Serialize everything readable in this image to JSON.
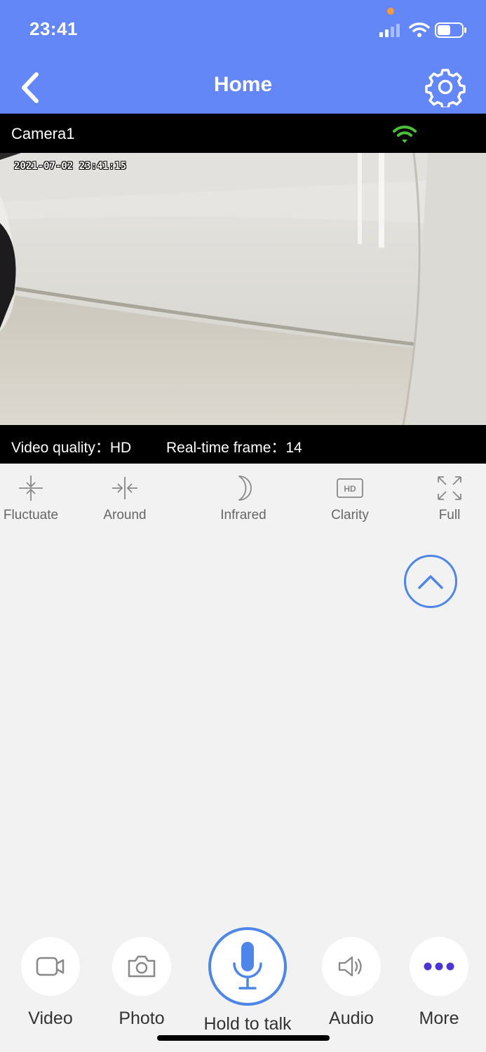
{
  "status_bar": {
    "time": "23:41"
  },
  "nav": {
    "title": "Home"
  },
  "camera": {
    "name": "Camera1",
    "timestamp": "2021-07-02 23:41:15"
  },
  "stream_info": {
    "quality": "Video quality：HD",
    "frame": "Real-time frame：14"
  },
  "controls": [
    {
      "label": "Fluctuate",
      "icon": "fluctuate-icon"
    },
    {
      "label": "Around",
      "icon": "around-icon"
    },
    {
      "label": "Infrared",
      "icon": "moon-icon"
    },
    {
      "label": "Clarity",
      "icon": "hd-icon"
    },
    {
      "label": "Full",
      "icon": "fullscreen-icon"
    }
  ],
  "actions": [
    {
      "label": "Video",
      "icon": "video-camera-icon"
    },
    {
      "label": "Photo",
      "icon": "camera-icon"
    },
    {
      "label": "Hold to talk",
      "icon": "microphone-icon"
    },
    {
      "label": "Audio",
      "icon": "speaker-icon"
    },
    {
      "label": "More",
      "icon": "more-dots-icon"
    }
  ],
  "colors": {
    "header": "#6387f7",
    "accent": "#4d86e8",
    "wifi_ok": "#4cbf3a",
    "more_dots": "#4a35d6"
  }
}
